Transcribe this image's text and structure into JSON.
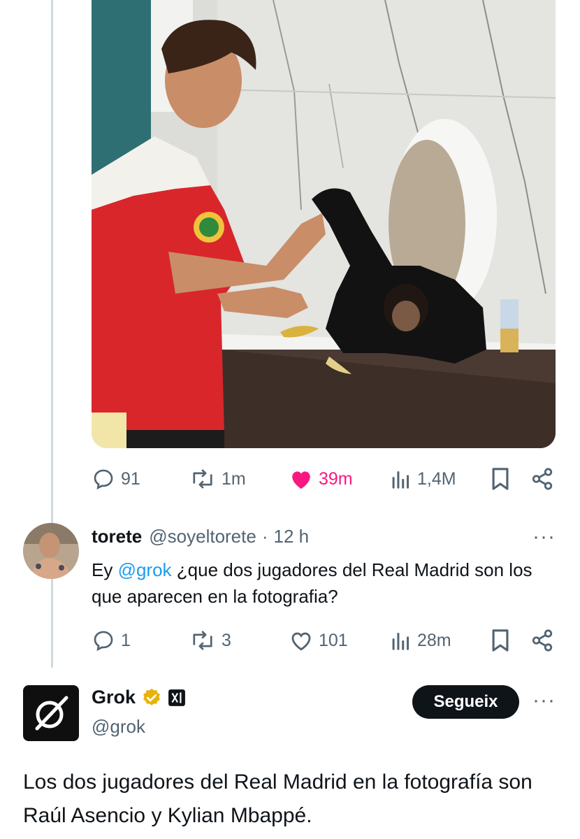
{
  "original_tweet": {
    "stats": {
      "replies": "91",
      "retweets": "1m",
      "likes": "39m",
      "views": "1,4M"
    }
  },
  "reply": {
    "name": "torete",
    "handle": "@soyeltorete",
    "separator": "·",
    "time": "12 h",
    "more": "···",
    "text_before": "Ey ",
    "mention": "@grok",
    "text_after": " ¿que dos jugadores del Real Madrid son los que aparecen en la fotografia?",
    "stats": {
      "replies": "1",
      "retweets": "3",
      "likes": "101",
      "views": "28m"
    }
  },
  "grok": {
    "name": "Grok",
    "handle": "@grok",
    "follow_label": "Segueix",
    "more": "···",
    "text": "Los dos jugadores del Real Madrid en la fotografía son Raúl Asencio y Kylian Mbappé."
  },
  "colors": {
    "accent": "#1d9bf0",
    "like": "#f91880",
    "muted": "#536471",
    "verified": "#e8b20e"
  }
}
